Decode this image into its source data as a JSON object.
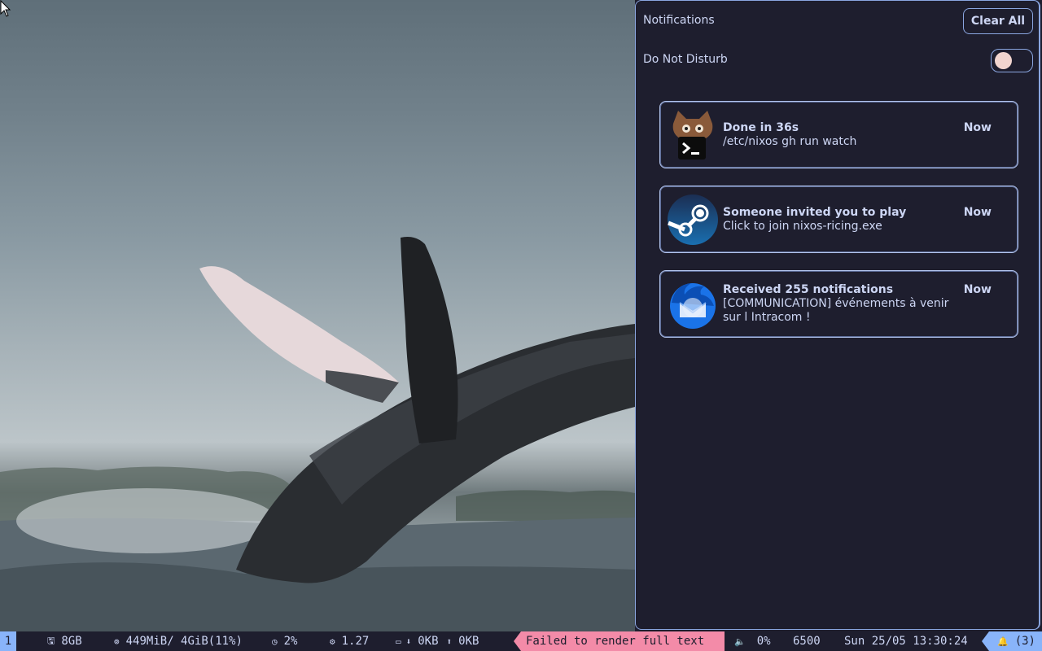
{
  "panel": {
    "title": "Notifications",
    "clear_all": "Clear All",
    "dnd_label": "Do Not Disturb",
    "dnd_enabled": false
  },
  "notifications": [
    {
      "icon": "terminal-cat-icon",
      "title": "Done in 36s",
      "time": "Now",
      "body": "/etc/nixos gh run watch"
    },
    {
      "icon": "steam-icon",
      "title": "Someone invited you to play",
      "time": "Now",
      "body": "Click to join nixos-ricing.exe"
    },
    {
      "icon": "thunderbird-icon",
      "title": "Received 255 notifications",
      "time": "Now",
      "body": "[COMMUNICATION] événements à venir sur l Intracom !"
    }
  ],
  "statusbar": {
    "workspace": "1",
    "disk": "8GB",
    "memory": "449MiB/ 4GiB(11%)",
    "cpu": "2%",
    "load": "1.27",
    "net_down": "0KB",
    "net_up": "0KB",
    "error": "Failed to render full text",
    "volume": "0%",
    "temperature": "6500",
    "clock": "Sun 25/05 13:30:24",
    "notif_count": "(3)"
  },
  "colors": {
    "panel_bg": "#1e1e2e",
    "accent": "#89b4fa",
    "error": "#f38ba8",
    "text": "#cdd6f4"
  }
}
